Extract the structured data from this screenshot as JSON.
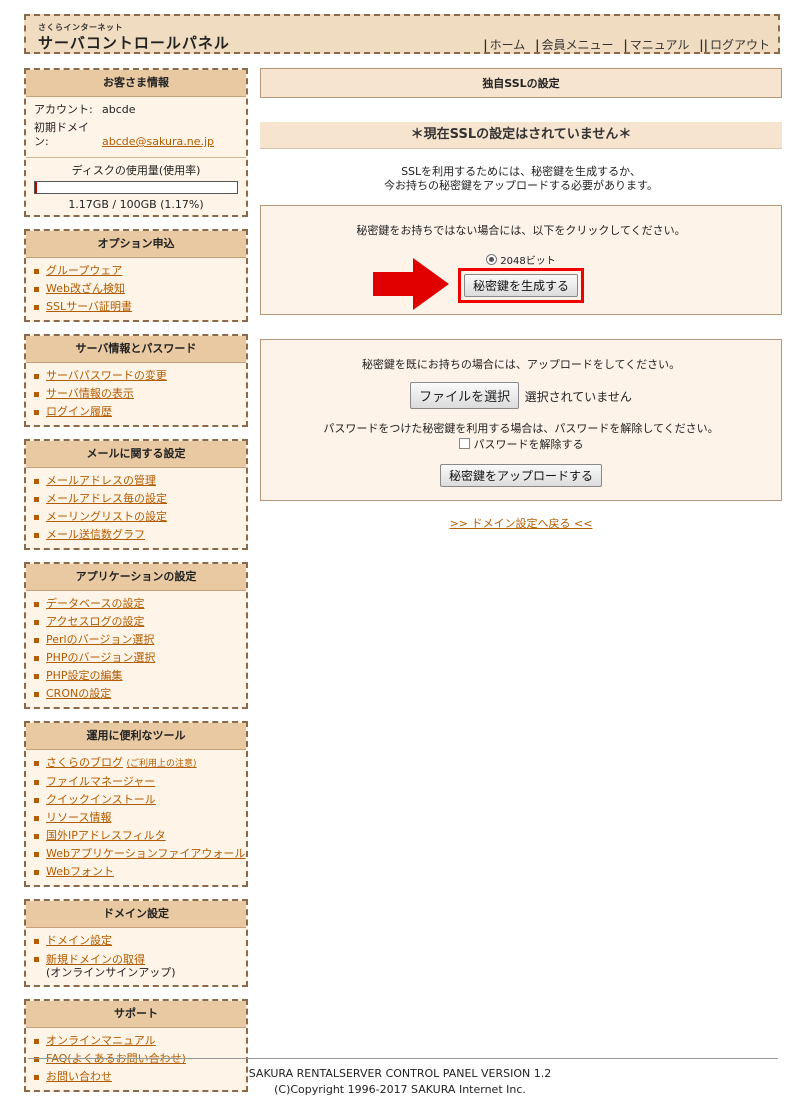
{
  "header": {
    "logo_sub": "さくらインターネット",
    "logo_main": "サーバコントロールパネル",
    "nav": [
      "ホーム",
      "会員メニュー",
      "マニュアル",
      "ログアウト"
    ]
  },
  "customer": {
    "title": "お客さま情報",
    "account_label": "アカウント:",
    "account_value": "abcde",
    "domain_label": "初期ドメイン:",
    "domain_value": "abcde@sakura.ne.jp",
    "disk_label": "ディスクの使用量(使用率)",
    "disk_usage": "1.17GB / 100GB (1.17%)",
    "disk_percent": 1.17
  },
  "sidebar": {
    "options": {
      "title": "オプション申込",
      "items": [
        "グループウェア",
        "Web改ざん検知",
        "SSLサーバ証明書"
      ]
    },
    "server": {
      "title": "サーバ情報とパスワード",
      "items": [
        "サーバパスワードの変更",
        "サーバ情報の表示",
        "ログイン履歴"
      ]
    },
    "mail": {
      "title": "メールに関する設定",
      "items": [
        "メールアドレスの管理",
        "メールアドレス毎の設定",
        "メーリングリストの設定",
        "メール送信数グラフ"
      ]
    },
    "app": {
      "title": "アプリケーションの設定",
      "items": [
        "データベースの設定",
        "アクセスログの設定",
        "Perlのバージョン選択",
        "PHPのバージョン選択",
        "PHP設定の編集",
        "CRONの設定"
      ]
    },
    "tools": {
      "title": "運用に便利なツール",
      "items": [
        "さくらのブログ",
        "ファイルマネージャー",
        "クイックインストール",
        "リソース情報",
        "国外IPアドレスフィルタ",
        "Webアプリケーションファイアウォール",
        "Webフォント"
      ],
      "blog_note": "(ご利用上の注意)"
    },
    "domain": {
      "title": "ドメイン設定",
      "items": [
        "ドメイン設定",
        "新規ドメインの取得"
      ],
      "new_domain_note": "(オンラインサインアップ)"
    },
    "support": {
      "title": "サポート",
      "items": [
        "オンラインマニュアル",
        "FAQ(よくあるお問い合わせ)",
        "お問い合わせ"
      ]
    }
  },
  "main": {
    "title": "独自SSLの設定",
    "notice": "＊現在SSLの設定はされていません＊",
    "desc_line1": "SSLを利用するためには、秘密鍵を生成するか、",
    "desc_line2": "今お持ちの秘密鍵をアップロードする必要があります。",
    "generate": {
      "instruction": "秘密鍵をお持ちではない場合には、以下をクリックしてください。",
      "radio_label": "2048ビット",
      "button": "秘密鍵を生成する"
    },
    "upload": {
      "instruction": "秘密鍵を既にお持ちの場合には、アップロードをしてください。",
      "file_button": "ファイルを選択",
      "file_status": "選択されていません",
      "password_instruction": "パスワードをつけた秘密鍵を利用する場合は、パスワードを解除してください。",
      "checkbox_label": "パスワードを解除する",
      "button": "秘密鍵をアップロードする"
    },
    "back_link": ">> ドメイン設定へ戻る <<"
  },
  "footer": {
    "version": "SAKURA RENTALSERVER CONTROL PANEL VERSION 1.2",
    "copyright": "(C)Copyright 1996-2017 SAKURA Internet Inc."
  },
  "colors": {
    "accent": "#b35c00",
    "highlight": "#e00000",
    "panel_bg": "#fdf3e8",
    "title_bg": "#e8c9a2"
  },
  "icons": {
    "arrow": "right-arrow-icon",
    "bullet": "square-bullet-icon"
  }
}
